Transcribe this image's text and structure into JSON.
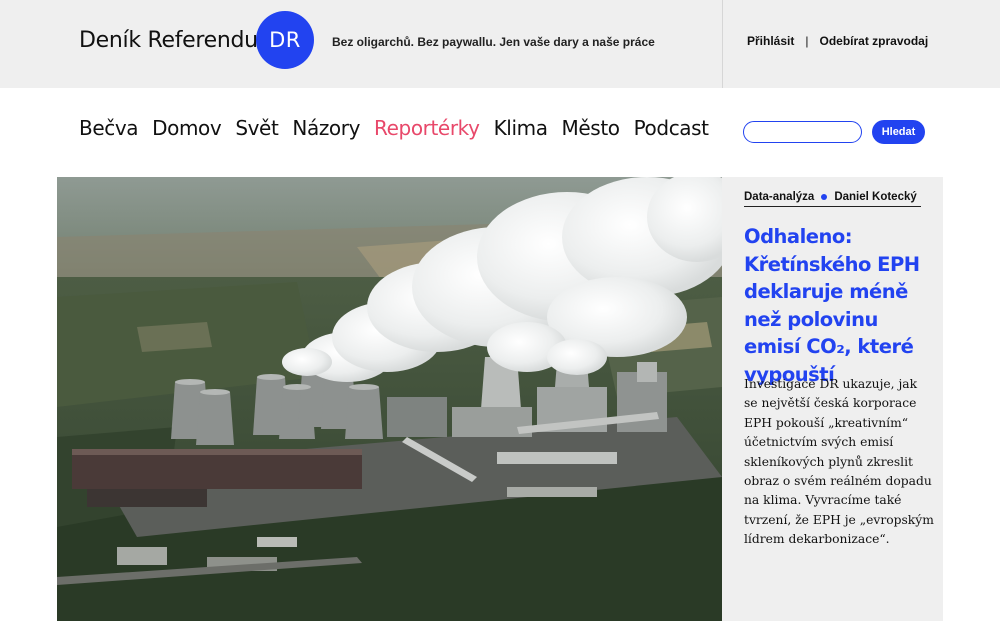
{
  "header": {
    "brand": "Deník Referendum",
    "logo_text": "DR",
    "tagline": "Bez oligarchů. Bez paywallu. Jen vaše dary a naše práce",
    "login_label": "Přihlásit",
    "separator": "|",
    "subscribe_label": "Odebírat zpravodaj"
  },
  "nav": {
    "items": [
      {
        "label": "Bečva"
      },
      {
        "label": "Domov"
      },
      {
        "label": "Svět"
      },
      {
        "label": "Názory"
      },
      {
        "label": "Reportérky",
        "active": true
      },
      {
        "label": "Klima"
      },
      {
        "label": "Město"
      },
      {
        "label": "Podcast"
      }
    ],
    "search_placeholder": "",
    "search_button": "Hledat"
  },
  "article": {
    "category": "Data-analýza",
    "author": "Daniel Kotecký",
    "title": "Odhaleno: Křetínského EPH deklaruje méně než polovinu emisí CO₂, které vypouští",
    "perex": "Investigace DR ukazuje, jak se největší česká korporace EPH pokouší „kreativním“ účetnictvím svých emisí skleníkových plynů zkreslit obraz o svém reálném dopadu na klima. Vyvracíme také tvrzení, že EPH je „evropským lídrem dekarbonizace“."
  },
  "colors": {
    "accent": "#2243f0",
    "active_nav": "#e8486a",
    "topbar_bg": "#efefef"
  }
}
